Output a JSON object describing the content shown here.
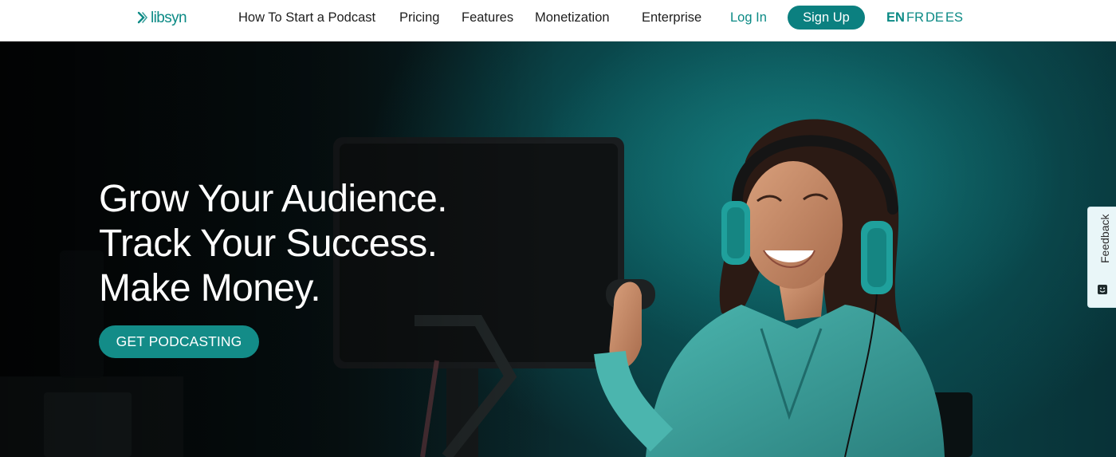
{
  "brand": {
    "name": "libsyn",
    "color": "#0b8a85",
    "logo_icon": "libsyn-mark-icon"
  },
  "nav": {
    "links": [
      {
        "label": "How To Start a Podcast"
      },
      {
        "label": "Pricing"
      },
      {
        "label": "Features"
      },
      {
        "label": "Monetization"
      },
      {
        "label": "Enterprise"
      }
    ],
    "login_label": "Log In",
    "signup_label": "Sign Up",
    "languages": {
      "en": "EN",
      "fr": "FR",
      "de": "DE",
      "es": "ES",
      "active": "EN"
    }
  },
  "hero": {
    "headline": [
      "Grow Your Audience.",
      "Track Your Success.",
      "Make Money."
    ],
    "cta_label": "GET PODCASTING",
    "accent_color": "#138c88"
  },
  "feedback_tab": {
    "label": "Feedback",
    "icon": "feedback-smile-icon"
  }
}
